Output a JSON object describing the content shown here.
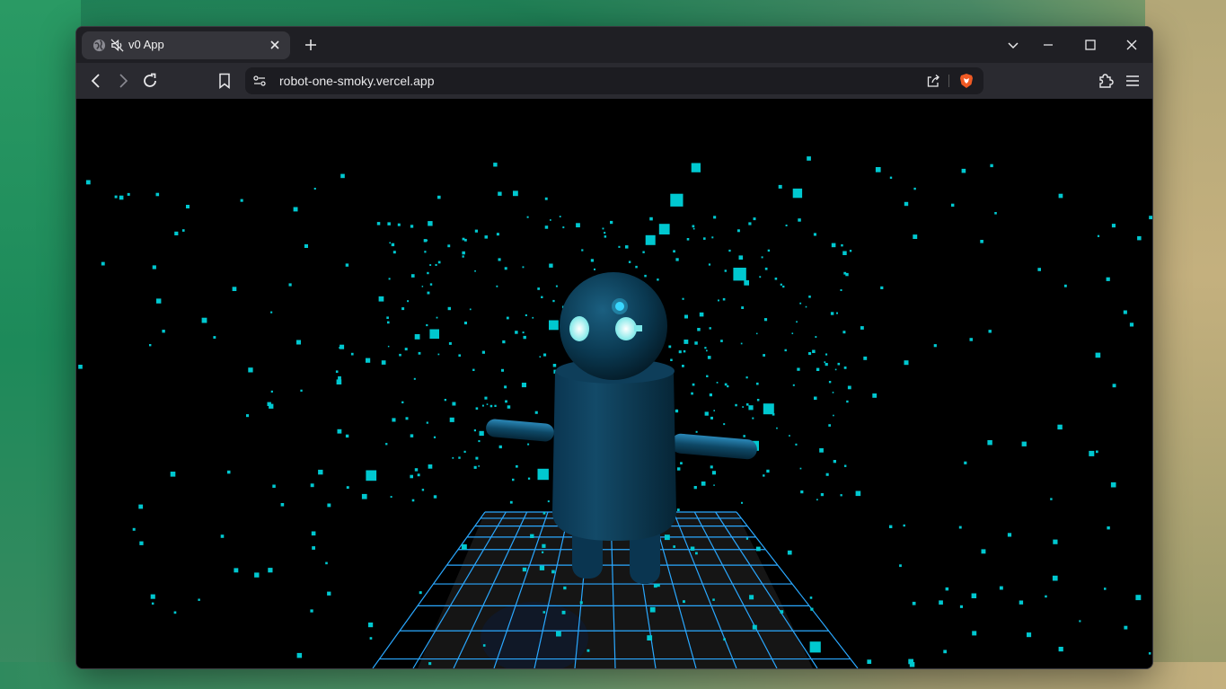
{
  "browser": {
    "tab": {
      "title": "v0 App"
    },
    "address_bar": {
      "url": "robot-one-smoky.vercel.app"
    },
    "icons": {
      "tab_site": "globe-icon",
      "tab_audio": "muted-speaker-icon",
      "tab_close": "close-icon",
      "new_tab": "plus-icon",
      "tab_list": "chevron-down-icon",
      "minimize": "minimize-icon",
      "maximize": "maximize-icon",
      "close_window": "close-icon",
      "back": "back-arrow-icon",
      "forward": "forward-arrow-icon",
      "reload": "reload-icon",
      "bookmark": "bookmark-icon",
      "site_info": "site-settings-icon",
      "share": "share-icon",
      "shields": "brave-shields-icon",
      "extensions": "puzzle-icon",
      "menu": "hamburger-menu-icon"
    }
  },
  "scene": {
    "background": "#000000",
    "particle_color": "#00c8d0",
    "grid_color": "#2aa8ff",
    "robot_color": "#0b3b55",
    "eye_color": "#b8fff6"
  }
}
